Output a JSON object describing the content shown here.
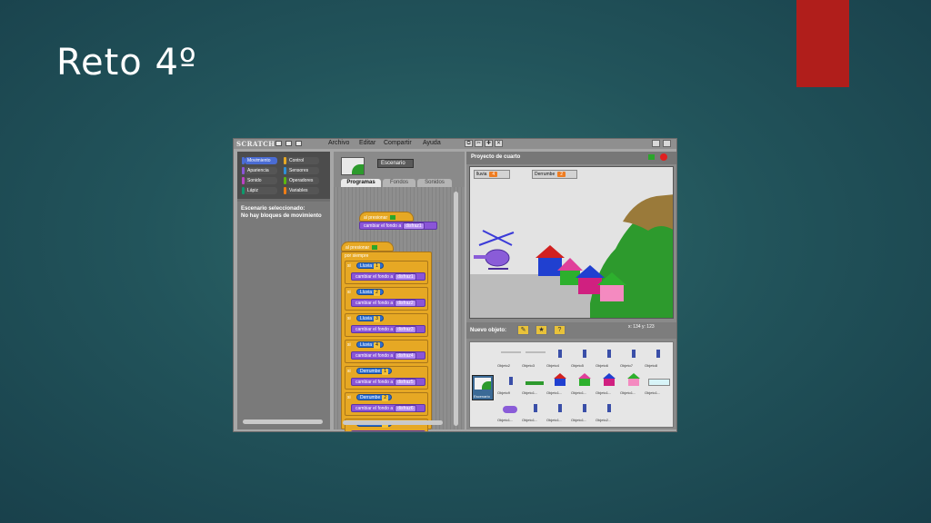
{
  "slide": {
    "title": "Reto 4º"
  },
  "app": {
    "logo": "SCRATCH",
    "menus": [
      "Archivo",
      "Editar",
      "Compartir",
      "Ayuda"
    ]
  },
  "categories": [
    {
      "label": "Movimiento",
      "color": "#4a6cd4"
    },
    {
      "label": "Control",
      "color": "#e6a824"
    },
    {
      "label": "Apariencia",
      "color": "#8a55d7"
    },
    {
      "label": "Sensores",
      "color": "#2f8fd6"
    },
    {
      "label": "Sonido",
      "color": "#bb42c3"
    },
    {
      "label": "Operadores",
      "color": "#5cb712"
    },
    {
      "label": "Lápiz",
      "color": "#0e9a6c"
    },
    {
      "label": "Variables",
      "color": "#ee7d16"
    }
  ],
  "palette": {
    "line1": "Escenario seleccionado:",
    "line2": "No hay bloques de movimiento"
  },
  "sprite_info": {
    "name": "Escenario"
  },
  "tabs": [
    "Programas",
    "Fondos",
    "Sonidos"
  ],
  "script": {
    "hat1": "al presionar",
    "switch1": "cambiar el fondo a",
    "switch1_val": "disfraz1",
    "hat2": "al presionar",
    "forever": "por siempre",
    "if_label": "si",
    "change_label": "cambiar el fondo a",
    "lluvia": "Lluvia",
    "derrumbe": "Derrumbe",
    "rows": [
      {
        "var": "Lluvia",
        "num": "1",
        "costume": "disfraz1"
      },
      {
        "var": "Lluvia",
        "num": "2",
        "costume": "disfraz2"
      },
      {
        "var": "Lluvia",
        "num": "3",
        "costume": "disfraz3"
      },
      {
        "var": "Lluvia",
        "num": "4",
        "costume": "disfraz4"
      },
      {
        "var": "Derrumbe",
        "num": "1",
        "costume": "disfraz5"
      },
      {
        "var": "Derrumbe",
        "num": "2",
        "costume": "disfraz6"
      },
      {
        "var": "Derrumbe",
        "num": "3",
        "costume": ""
      }
    ]
  },
  "stage": {
    "title": "Proyecto de cuarto",
    "var1": {
      "label": "lluvia",
      "value": "4"
    },
    "var2": {
      "label": "Derrumbe",
      "value": "2"
    },
    "coords": "x: 134   y: 123"
  },
  "new_sprite": {
    "label": "Nuevo objeto:"
  },
  "sprites": {
    "stage_label": "Escenario",
    "row1": [
      "Objeto2",
      "Objeto3",
      "Objeto4",
      "Objeto5",
      "Objeto6",
      "Objeto7",
      "Objeto8"
    ],
    "row2": [
      "Objeto9",
      "Objeto1...",
      "Objeto1...",
      "Objeto1...",
      "Objeto1...",
      "Objeto1...",
      "Objeto1..."
    ],
    "row3": [
      "Objeto1...",
      "Objeto1...",
      "Objeto1...",
      "Objeto1...",
      "Objeto2..."
    ]
  }
}
